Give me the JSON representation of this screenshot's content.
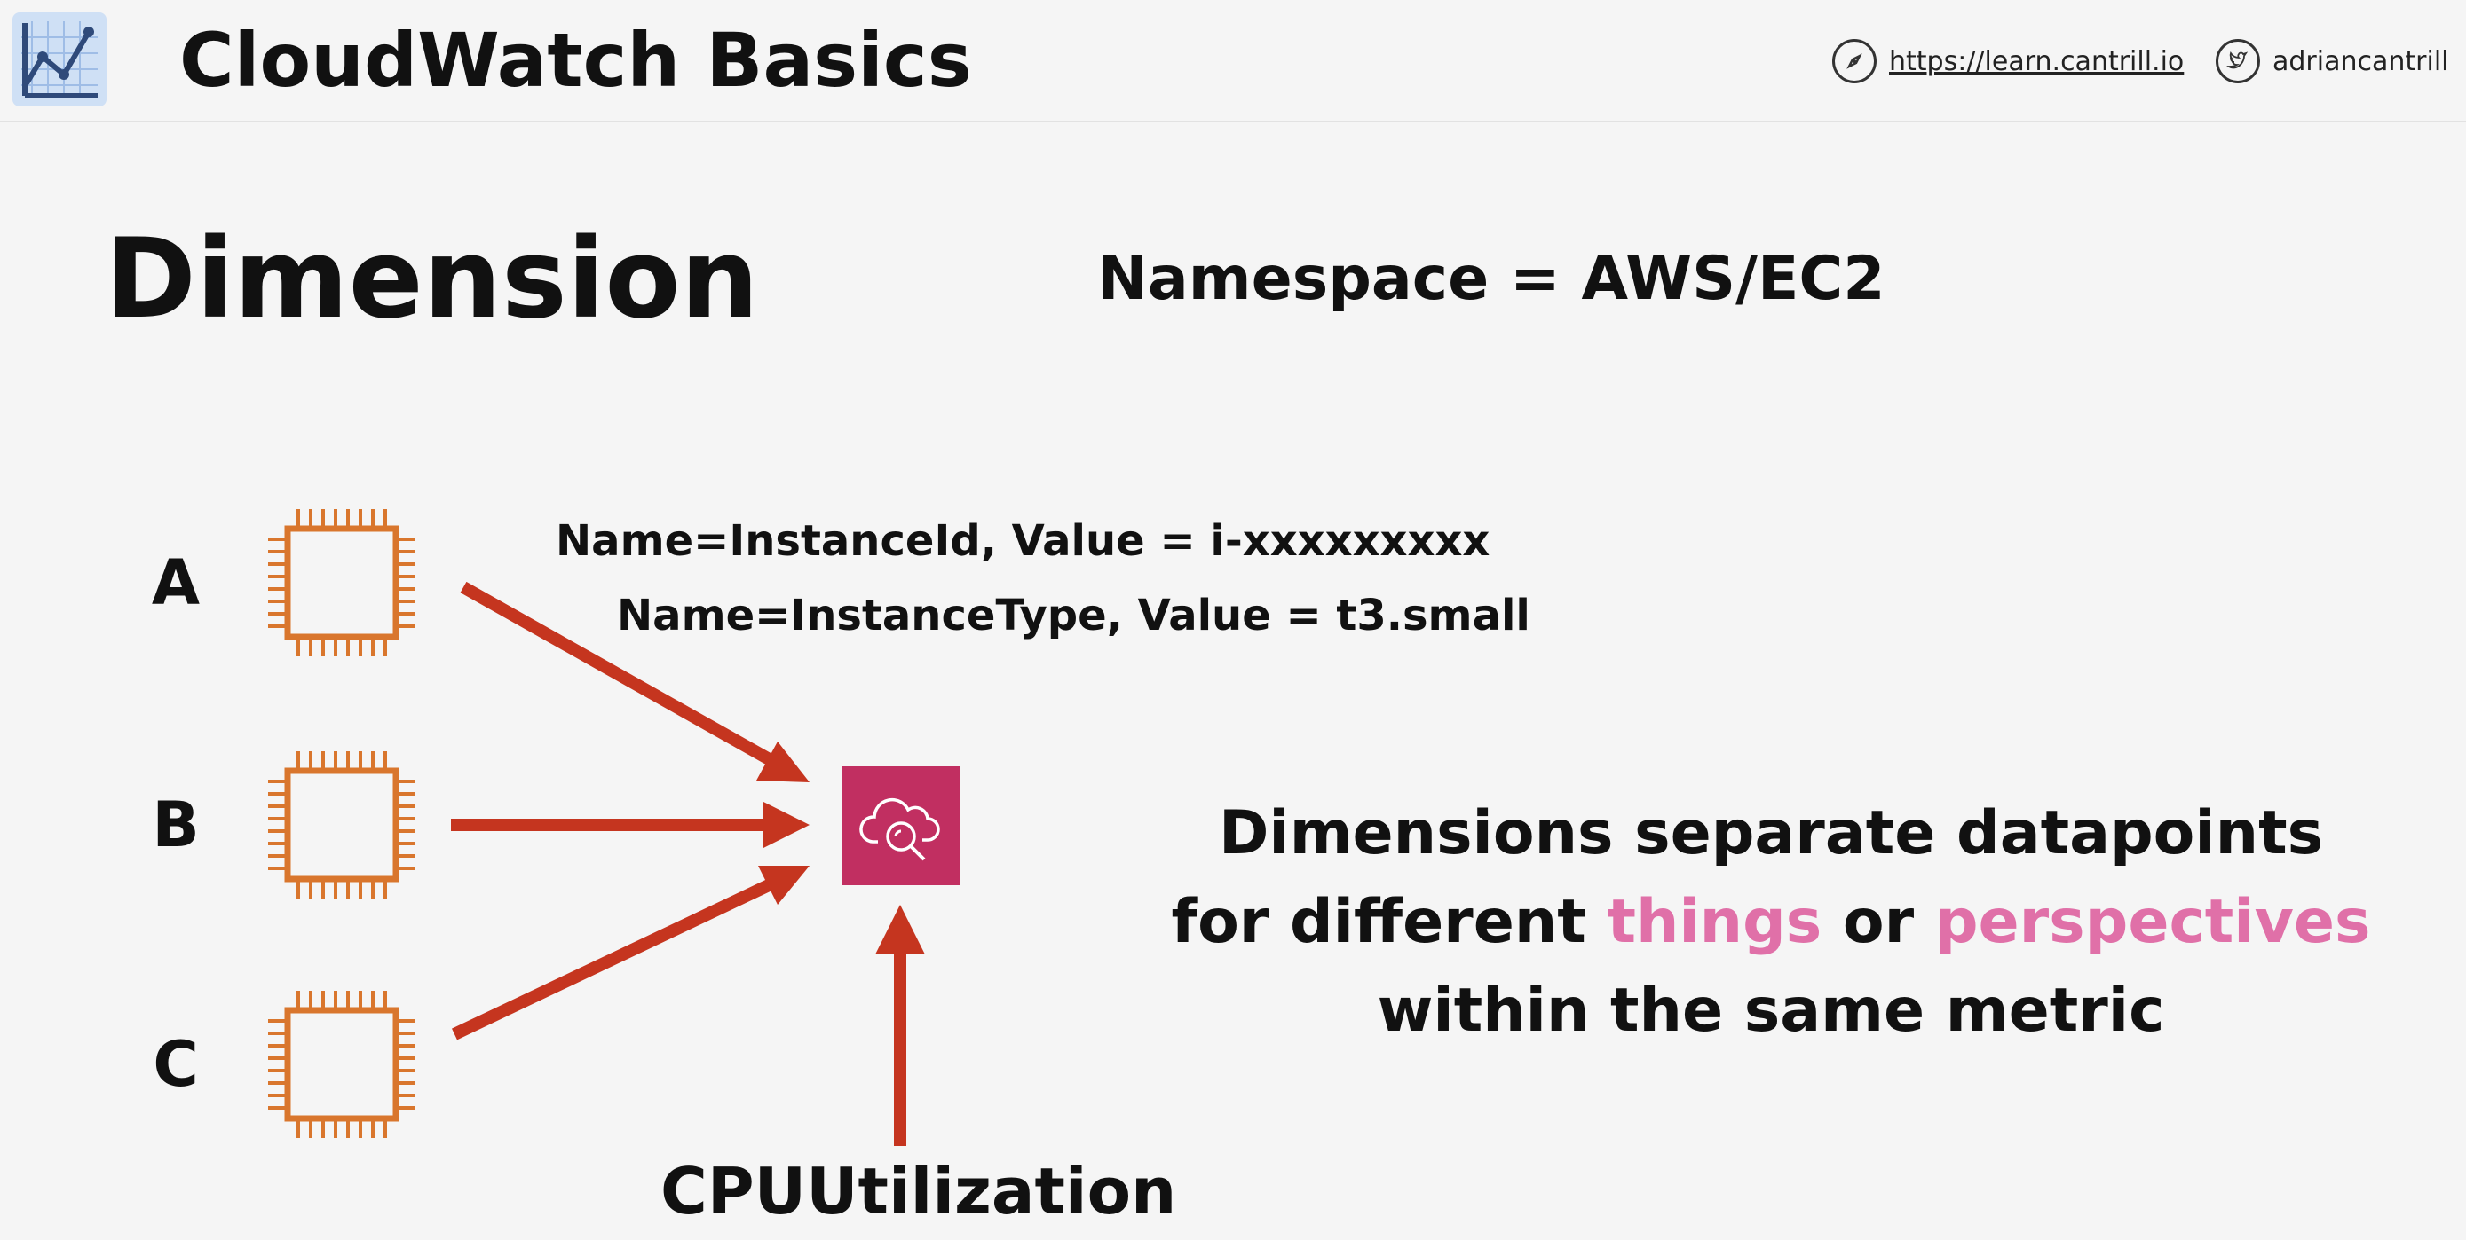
{
  "header": {
    "title": "CloudWatch Basics",
    "site_link": "https://learn.cantrill.io",
    "twitter_handle": "adriancantrill"
  },
  "slide": {
    "title": "Dimension",
    "namespace": "Namespace = AWS/EC2",
    "dimension_1": "Name=InstanceId, Value = i-xxxxxxxxx",
    "dimension_2": "Name=InstanceType, Value = t3.small",
    "instances": [
      "A",
      "B",
      "C"
    ],
    "metric": "CPUUtilization",
    "note": {
      "part1": "Dimensions separate datapoints",
      "part2_prefix": "for different ",
      "highlight1": "things",
      "part2_mid": " or ",
      "highlight2": "perspectives",
      "part3": "within the same metric"
    }
  },
  "colors": {
    "chip": "#d9762d",
    "arrow": "#c5351f",
    "cloudwatch": "#c12f61",
    "highlight": "#e070a8"
  },
  "icons": [
    "chart-logo-icon",
    "compass-icon",
    "twitter-icon",
    "ec2-instance-icon",
    "cloudwatch-icon"
  ]
}
